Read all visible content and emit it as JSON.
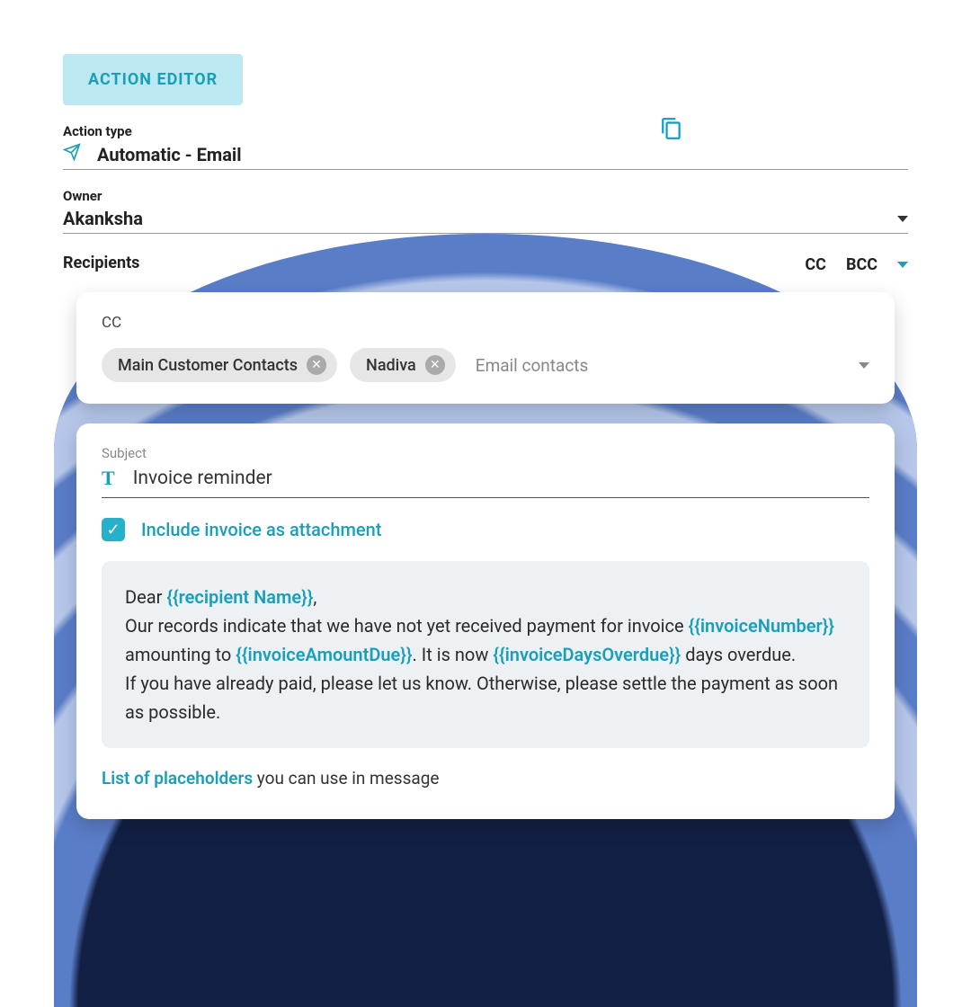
{
  "header": {
    "badge": "ACTION EDITOR"
  },
  "actionType": {
    "label": "Action type",
    "value": "Automatic - Email"
  },
  "owner": {
    "label": "Owner",
    "value": "Akanksha"
  },
  "recipients": {
    "label": "Recipients",
    "cc": "CC",
    "bcc": "BCC"
  },
  "ccCard": {
    "title": "CC",
    "chips": [
      "Main Customer Contacts",
      "Nadiva"
    ],
    "placeholder": "Email contacts"
  },
  "subject": {
    "label": "Subject",
    "value": "Invoice reminder"
  },
  "attachment": {
    "label": "Include invoice as attachment",
    "checked": true
  },
  "message": {
    "parts": [
      {
        "t": "text",
        "v": "Dear "
      },
      {
        "t": "ph",
        "v": "{{recipient Name}}"
      },
      {
        "t": "text",
        "v": ","
      },
      {
        "t": "br"
      },
      {
        "t": "text",
        "v": "Our records indicate that we have not yet received payment for invoice "
      },
      {
        "t": "ph",
        "v": "{{invoiceNumber}}"
      },
      {
        "t": "text",
        "v": " amounting to "
      },
      {
        "t": "ph",
        "v": "{{invoiceAmountDue}}"
      },
      {
        "t": "text",
        "v": ". It is now "
      },
      {
        "t": "ph",
        "v": "{{invoiceDaysOverdue}}"
      },
      {
        "t": "text",
        "v": " days overdue."
      },
      {
        "t": "br"
      },
      {
        "t": "text",
        "v": "If you have already paid, please let us know. Otherwise, please settle the payment as soon as possible."
      }
    ]
  },
  "placeholdersNote": {
    "link": "List of placeholders",
    "rest": " you can use in message"
  }
}
